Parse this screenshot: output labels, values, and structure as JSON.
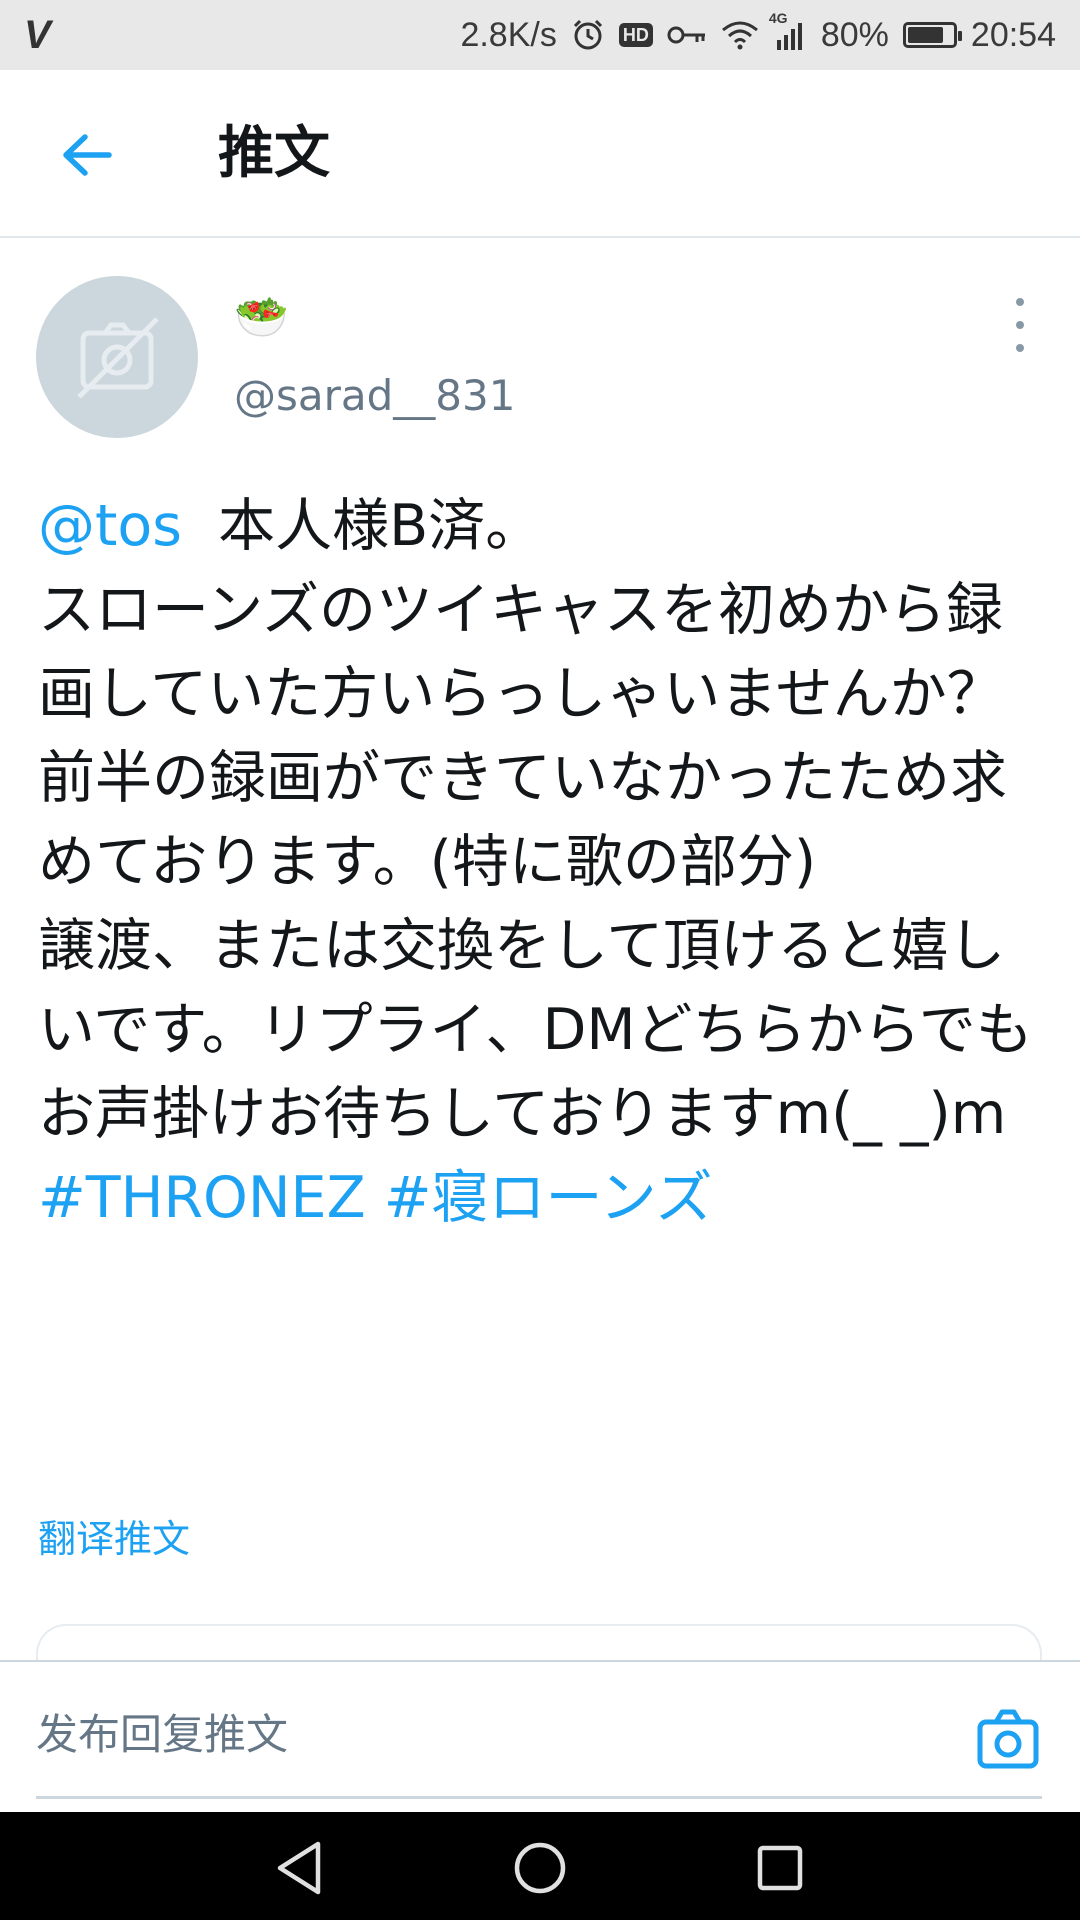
{
  "status_bar": {
    "carrier_logo": "V",
    "network_speed": "2.8K/s",
    "hd_badge": "HD",
    "network_type": "4G",
    "battery_percent": "80%",
    "battery_level": 0.8,
    "time": "20:54",
    "icons": [
      "alarm-icon",
      "hd-icon",
      "vpn-key-icon",
      "wifi-icon",
      "signal-icon",
      "battery-icon"
    ]
  },
  "header": {
    "back_icon": "arrow-left-icon",
    "title": "推文"
  },
  "tweet": {
    "avatar_icon": "no-image-icon",
    "display_name": "🥗",
    "handle": "@sarad__831",
    "more_icon": "more-vertical-icon",
    "mention": "@tos",
    "body_main": "  本人様B済。\nスローンズのツイキャスを初めから録画していた方いらっしゃいませんか？\n前半の録画ができていなかったため求めております。(特に歌の部分)\n譲渡、または交換をして頂けると嬉しいです。リプライ、DMどちらからでもお声掛けお待ちしておりますm(_ _)m ",
    "hashtag_1": "#THRONEZ",
    "hashtag_2": "#寝ローンズ",
    "translate_label": "翻译推文"
  },
  "reply": {
    "placeholder": "发布回复推文",
    "camera_icon": "camera-icon"
  },
  "nav_bar": {
    "icons": [
      "back-triangle-icon",
      "home-circle-icon",
      "recents-square-icon"
    ]
  },
  "colors": {
    "accent": "#1da1f2",
    "text": "#14171a",
    "secondary": "#657786",
    "status_bar_bg": "#e8e8e8"
  }
}
